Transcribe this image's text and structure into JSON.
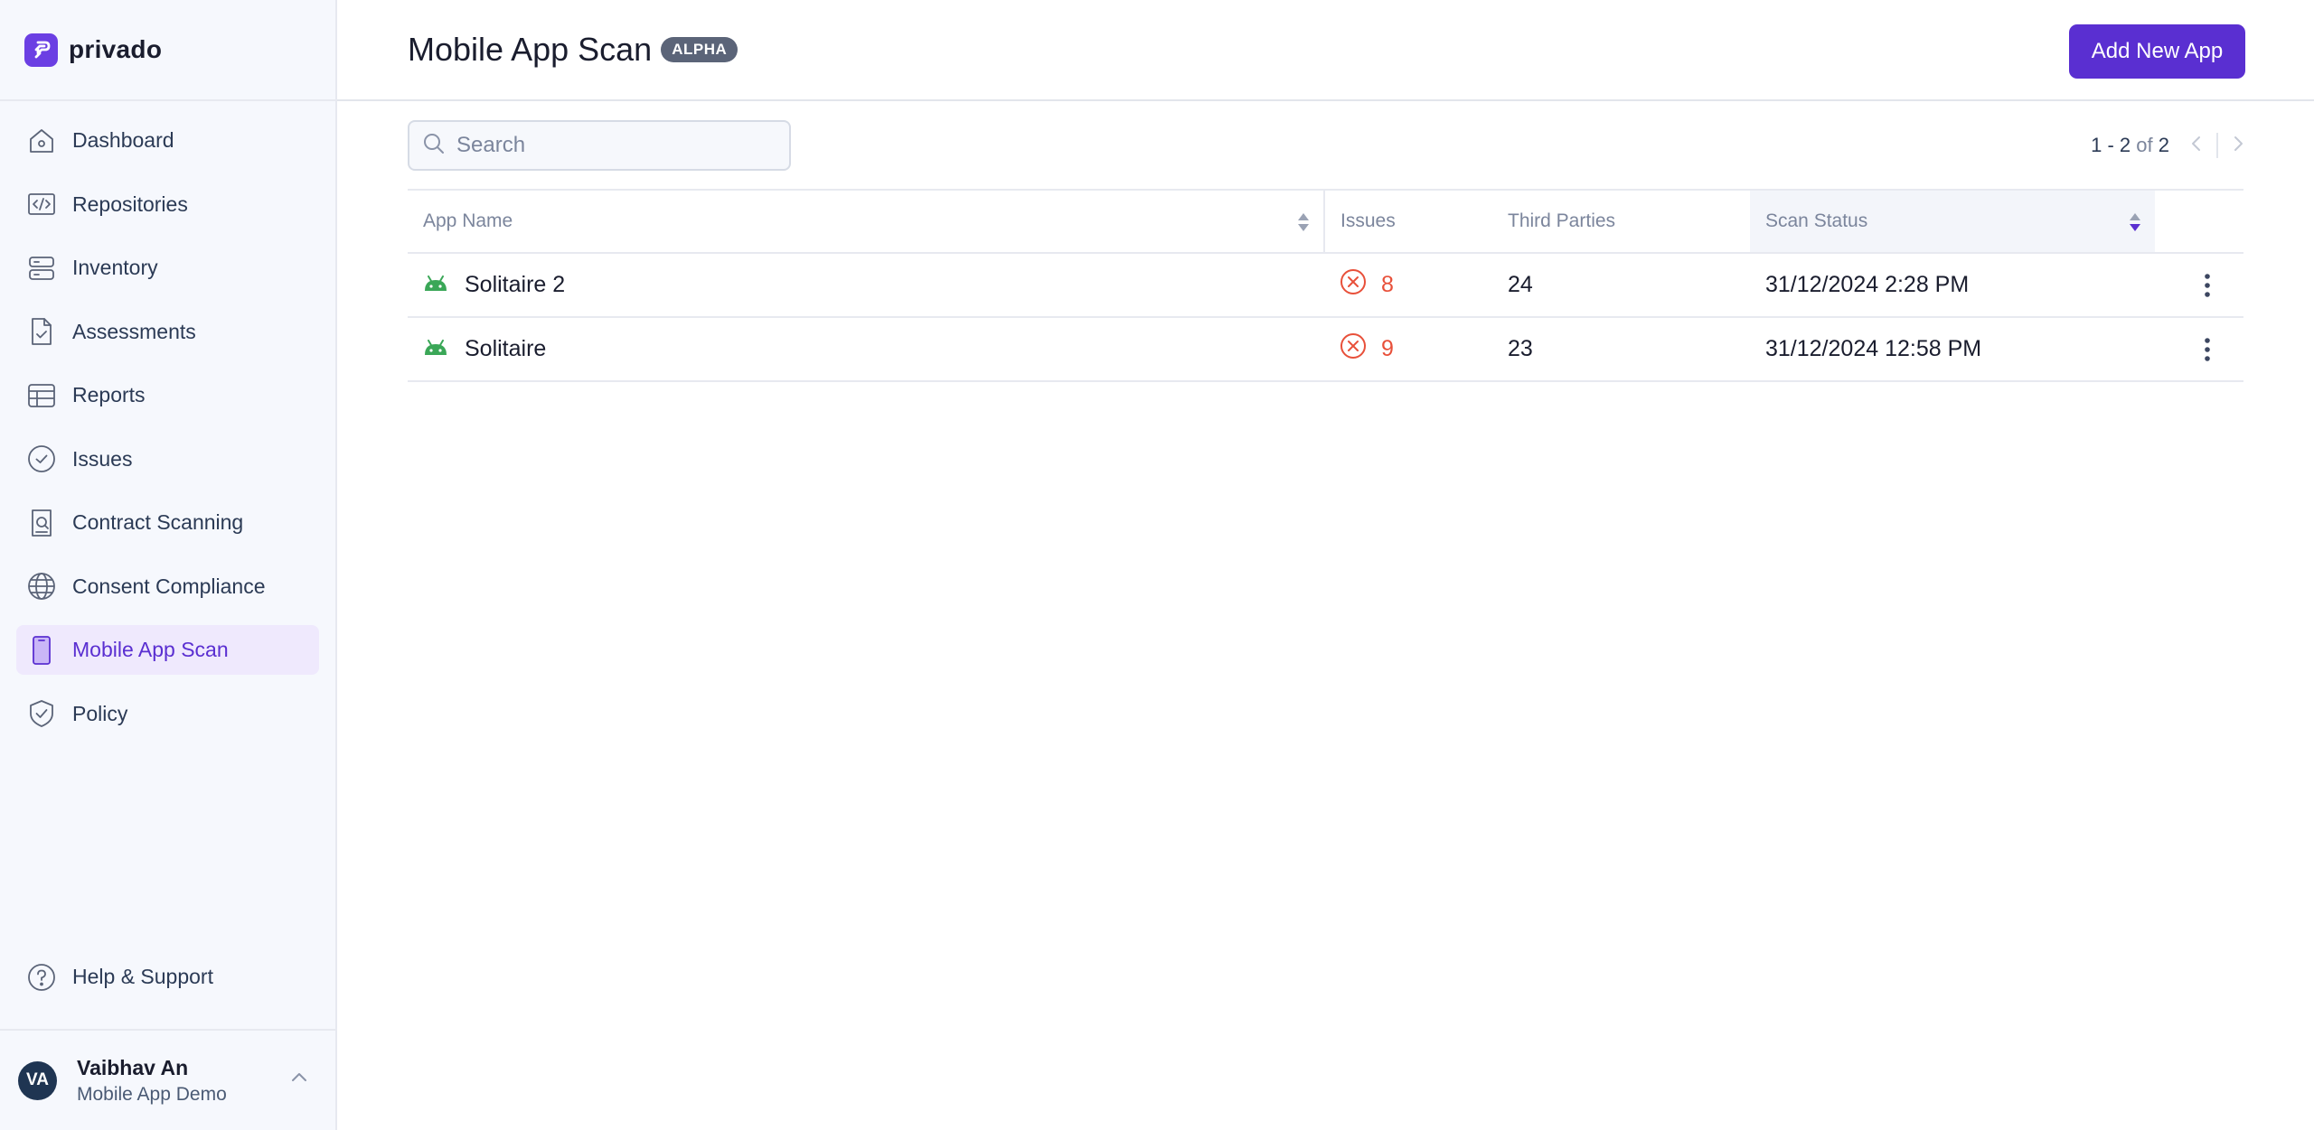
{
  "brand": {
    "name": "privado"
  },
  "sidebar": {
    "items": [
      {
        "label": "Dashboard",
        "icon": "home-icon"
      },
      {
        "label": "Repositories",
        "icon": "code-icon"
      },
      {
        "label": "Inventory",
        "icon": "server-icon"
      },
      {
        "label": "Assessments",
        "icon": "document-check-icon"
      },
      {
        "label": "Reports",
        "icon": "table-icon"
      },
      {
        "label": "Issues",
        "icon": "check-circle-icon"
      },
      {
        "label": "Contract Scanning",
        "icon": "document-search-icon"
      },
      {
        "label": "Consent Compliance",
        "icon": "globe-icon"
      },
      {
        "label": "Mobile App Scan",
        "icon": "mobile-icon",
        "active": true
      },
      {
        "label": "Policy",
        "icon": "shield-check-icon"
      }
    ],
    "help": {
      "label": "Help & Support"
    },
    "user": {
      "initials": "VA",
      "name": "Vaibhav An",
      "org": "Mobile App Demo"
    }
  },
  "header": {
    "title": "Mobile App Scan",
    "badge": "ALPHA",
    "add_button": "Add New App"
  },
  "search": {
    "placeholder": "Search"
  },
  "pagination": {
    "range": "1 - 2",
    "of": "of",
    "total": "2"
  },
  "table": {
    "columns": [
      "App Name",
      "Issues",
      "Third Parties",
      "Scan Status"
    ],
    "rows": [
      {
        "name": "Solitaire 2",
        "issues": "8",
        "third_parties": "24",
        "scan_status": "31/12/2024 2:28 PM"
      },
      {
        "name": "Solitaire",
        "issues": "9",
        "third_parties": "23",
        "scan_status": "31/12/2024 12:58 PM"
      }
    ]
  },
  "colors": {
    "accent": "#5a2fd1",
    "android": "#3aa757",
    "issue": "#e8503a",
    "sidebar_bg": "#f6f8fd"
  }
}
